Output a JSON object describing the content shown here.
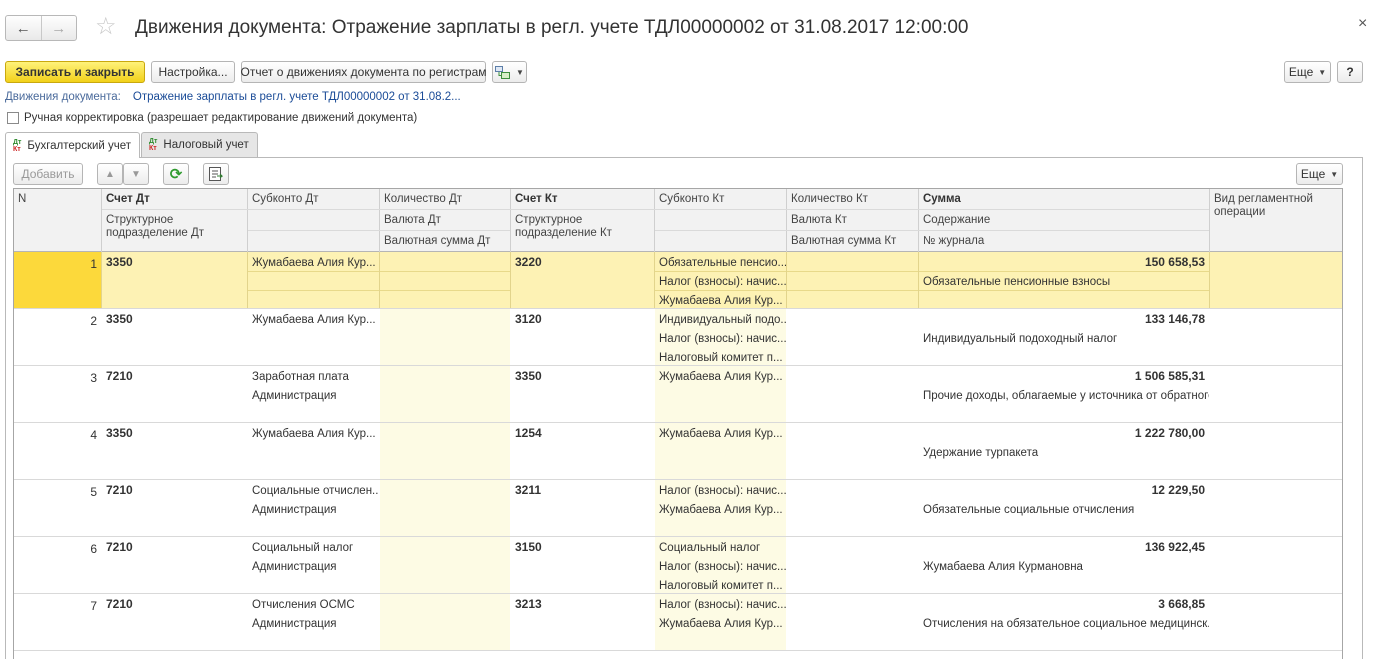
{
  "window": {
    "title": "Движения документа: Отражение зарплаты в регл. учете ТДЛ00000002 от 31.08.2017 12:00:00",
    "back_icon": "←",
    "forward_icon": "→",
    "star_icon": "☆",
    "close_icon": "×"
  },
  "toolbar": {
    "save_close": "Записать и закрыть",
    "settings": "Настройка...",
    "report": "Отчет о движениях документа по регистрам",
    "more": "Еще",
    "help": "?"
  },
  "document_link": {
    "label": "Движения документа:",
    "value": "Отражение зарплаты в регл. учете ТДЛ00000002 от 31.08.2..."
  },
  "manual_edit": {
    "label": "Ручная корректировка (разрешает редактирование движений документа)",
    "checked": false
  },
  "tabs": [
    {
      "label": "Бухгалтерский учет",
      "icon_top": "Дт",
      "icon_bottom": "Кт",
      "active": true
    },
    {
      "label": "Налоговый учет",
      "icon_top": "Дт",
      "icon_bottom": "Кт",
      "active": false
    }
  ],
  "table_toolbar": {
    "add": "Добавить",
    "up_icon": "▲",
    "down_icon": "▼",
    "refresh_icon": "⟳",
    "more": "Еще"
  },
  "columns": {
    "n": "N",
    "acc_dt": "Счет Дт",
    "div_dt": "Структурное подразделение Дт",
    "sub_dt": "Субконто Дт",
    "qty_dt": "Количество Дт",
    "cur_dt": "Валюта Дт",
    "cur_sum_dt": "Валютная сумма Дт",
    "acc_kt": "Счет Кт",
    "div_kt": "Структурное подразделение Кт",
    "sub_kt": "Субконто Кт",
    "qty_kt": "Количество Кт",
    "cur_kt": "Валюта Кт",
    "cur_sum_kt": "Валютная сумма Кт",
    "sum": "Сумма",
    "content": "Содержание",
    "journal": "№ журнала",
    "op_type": "Вид регламентной операции"
  },
  "rows": [
    {
      "n": "1",
      "acc_dt": "3350",
      "sub_dt": [
        "Жумабаева Алия Кур...",
        "",
        ""
      ],
      "acc_kt": "3220",
      "sub_kt": [
        "Обязательные пенсио...",
        "Налог (взносы): начис...",
        "Жумабаева Алия Кур..."
      ],
      "sum": "150 658,53",
      "content": "Обязательные пенсионные взносы"
    },
    {
      "n": "2",
      "acc_dt": "3350",
      "sub_dt": [
        "Жумабаева Алия Кур...",
        "",
        ""
      ],
      "acc_kt": "3120",
      "sub_kt": [
        "Индивидуальный подо...",
        "Налог (взносы): начис...",
        "Налоговый комитет п..."
      ],
      "sum": "133 146,78",
      "content": "Индивидуальный подоходный налог"
    },
    {
      "n": "3",
      "acc_dt": "7210",
      "sub_dt": [
        "Заработная плата",
        "Администрация",
        ""
      ],
      "acc_kt": "3350",
      "sub_kt": [
        "Жумабаева Алия Кур...",
        "",
        ""
      ],
      "sum": "1 506 585,31",
      "content": "Прочие доходы, облагаемые у источника от обратного"
    },
    {
      "n": "4",
      "acc_dt": "3350",
      "sub_dt": [
        "Жумабаева Алия Кур...",
        "",
        ""
      ],
      "acc_kt": "1254",
      "sub_kt": [
        "Жумабаева Алия Кур...",
        "",
        ""
      ],
      "sum": "1 222 780,00",
      "content": "Удержание турпакета"
    },
    {
      "n": "5",
      "acc_dt": "7210",
      "sub_dt": [
        "Социальные отчислен...",
        "Администрация",
        ""
      ],
      "acc_kt": "3211",
      "sub_kt": [
        "Налог (взносы): начис...",
        "Жумабаева Алия Кур...",
        ""
      ],
      "sum": "12 229,50",
      "content": "Обязательные социальные отчисления"
    },
    {
      "n": "6",
      "acc_dt": "7210",
      "sub_dt": [
        "Социальный налог",
        "Администрация",
        ""
      ],
      "acc_kt": "3150",
      "sub_kt": [
        "Социальный налог",
        "Налог (взносы): начис...",
        "Налоговый комитет п..."
      ],
      "sum": "136 922,45",
      "content": "Жумабаева Алия Курмановна"
    },
    {
      "n": "7",
      "acc_dt": "7210",
      "sub_dt": [
        "Отчисления ОСМС",
        "Администрация",
        ""
      ],
      "acc_kt": "3213",
      "sub_kt": [
        "Налог (взносы): начис...",
        "Жумабаева Алия Кур...",
        ""
      ],
      "sum": "3 668,85",
      "content": "Отчисления на обязательное социальное медицинск..."
    }
  ]
}
